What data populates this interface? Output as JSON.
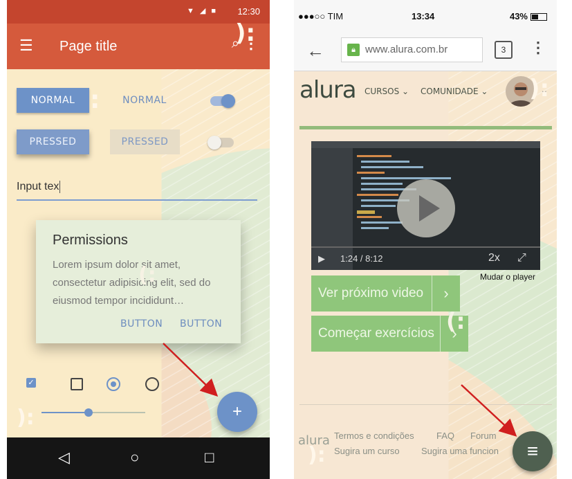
{
  "android": {
    "status_time": "12:30",
    "app_title": "Page title",
    "raised_normal": "NORMAL",
    "flat_normal": "NORMAL",
    "raised_pressed": "PRESSED",
    "flat_pressed": "PRESSED",
    "input_value": "Input tex",
    "dialog": {
      "title": "Permissions",
      "body": "Lorem ipsum dolor sit amet, consectetur adipisicing elit, sed do eiusmod tempor incididunt…",
      "button1": "BUTTON",
      "button2": "BUTTON"
    },
    "fab_label": "+",
    "checkbox_checked": true,
    "slider_value_fraction": 0.45,
    "nav": {
      "back": "◁",
      "home": "○",
      "recents": "□"
    }
  },
  "iphone": {
    "carrier": "●●●○○ TIM",
    "time": "13:34",
    "battery": "43%",
    "url": "www.alura.com.br",
    "tab_count": "3",
    "logo": "alura",
    "menu_cursos": "CURSOS",
    "menu_comunidade": "COMUNIDADE",
    "video_time": "1:24 / 8:12",
    "video_speed": "2x",
    "mudar_player": "Mudar o player",
    "btn_proximo": "Ver próximo video",
    "btn_exercicios": "Começar exercícios",
    "footer_logo": "alura",
    "footer_termos": "Termos e condições",
    "footer_faq": "FAQ",
    "footer_forum": "Forum",
    "footer_sugira_curso": "Sugira um curso",
    "footer_sugira_func": "Sugira uma funcion"
  },
  "colors": {
    "android_primary": "#d55a3c",
    "android_accent": "#6d92c8",
    "alura_green": "#8fc67b",
    "arrow_red": "#d01f1f"
  }
}
